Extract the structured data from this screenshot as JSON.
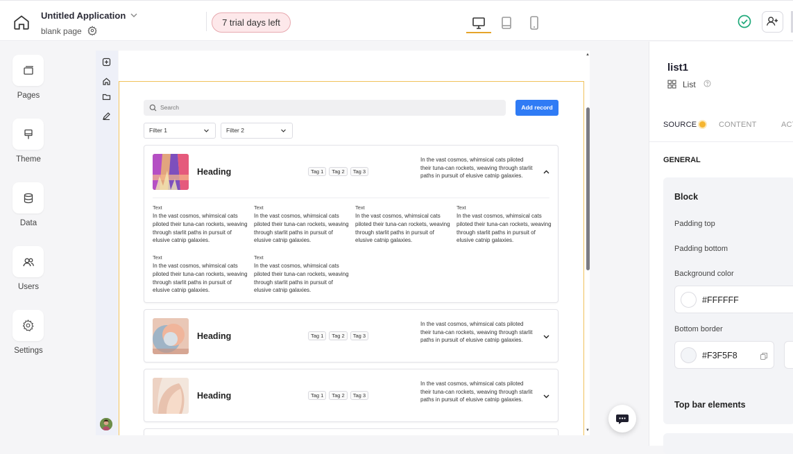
{
  "header": {
    "app_title": "Untitled Application",
    "page_name": "blank page",
    "trial_badge": "7 trial days left",
    "devices": [
      "desktop-icon",
      "tablet-icon",
      "mobile-icon"
    ],
    "active_device": "desktop",
    "accent": "#e5a42a"
  },
  "sidebar": {
    "items": [
      {
        "label": "Pages",
        "icon": "pages-icon"
      },
      {
        "label": "Theme",
        "icon": "brush-icon"
      },
      {
        "label": "Data",
        "icon": "database-icon"
      },
      {
        "label": "Users",
        "icon": "users-icon"
      },
      {
        "label": "Settings",
        "icon": "gear-icon"
      }
    ]
  },
  "canvas": {
    "search_placeholder": "Search",
    "add_button": "Add record",
    "filters": [
      "Filter 1",
      "Filter 2"
    ],
    "records": [
      {
        "heading": "Heading",
        "tags": [
          "Tag 1",
          "Tag 2",
          "Tag 3"
        ],
        "description": "In the vast cosmos, whimsical cats piloted their tuna-can rockets, weaving through starlit paths in pursuit of elusive catnip galaxies.",
        "expanded": true,
        "details": [
          {
            "label": "Text",
            "text": "In the vast cosmos, whimsical cats piloted their tuna-can rockets, weaving through starlit paths in pursuit of elusive catnip galaxies."
          },
          {
            "label": "Text",
            "text": "In the vast cosmos, whimsical cats piloted their tuna-can rockets, weaving through starlit paths in pursuit of elusive catnip galaxies."
          },
          {
            "label": "Text",
            "text": "In the vast cosmos, whimsical cats piloted their tuna-can rockets, weaving through starlit paths in pursuit of elusive catnip galaxies."
          },
          {
            "label": "Text",
            "text": "In the vast cosmos, whimsical cats piloted their tuna-can rockets, weaving through starlit paths in pursuit of elusive catnip galaxies."
          },
          {
            "label": "Text",
            "text": "In the vast cosmos, whimsical cats piloted their tuna-can rockets, weaving through starlit paths in pursuit of elusive catnip galaxies."
          },
          {
            "label": "Text",
            "text": "In the vast cosmos, whimsical cats piloted their tuna-can rockets, weaving through starlit paths in pursuit of elusive catnip galaxies."
          }
        ]
      },
      {
        "heading": "Heading",
        "tags": [
          "Tag 1",
          "Tag 2",
          "Tag 3"
        ],
        "description": "In the vast cosmos, whimsical cats piloted their tuna-can rockets, weaving through starlit paths in pursuit of elusive catnip galaxies.",
        "expanded": false
      },
      {
        "heading": "Heading",
        "tags": [
          "Tag 1",
          "Tag 2",
          "Tag 3"
        ],
        "description": "In the vast cosmos, whimsical cats piloted their tuna-can rockets, weaving through starlit paths in pursuit of elusive catnip galaxies.",
        "expanded": false
      }
    ]
  },
  "panel": {
    "component_name": "list1",
    "component_type": "List",
    "tabs": [
      "SOURCE",
      "CONTENT",
      "ACTIONS"
    ],
    "active_tab": "SOURCE",
    "general_label": "GENERAL",
    "block_title": "Block",
    "padding_top_label": "Padding top",
    "padding_bottom_label": "Padding bottom",
    "background_color_label": "Background color",
    "background_color_value": "#FFFFFF",
    "bottom_border_label": "Bottom border",
    "bottom_border_value": "#F3F5F8",
    "top_bar_elements_label": "Top bar elements"
  }
}
